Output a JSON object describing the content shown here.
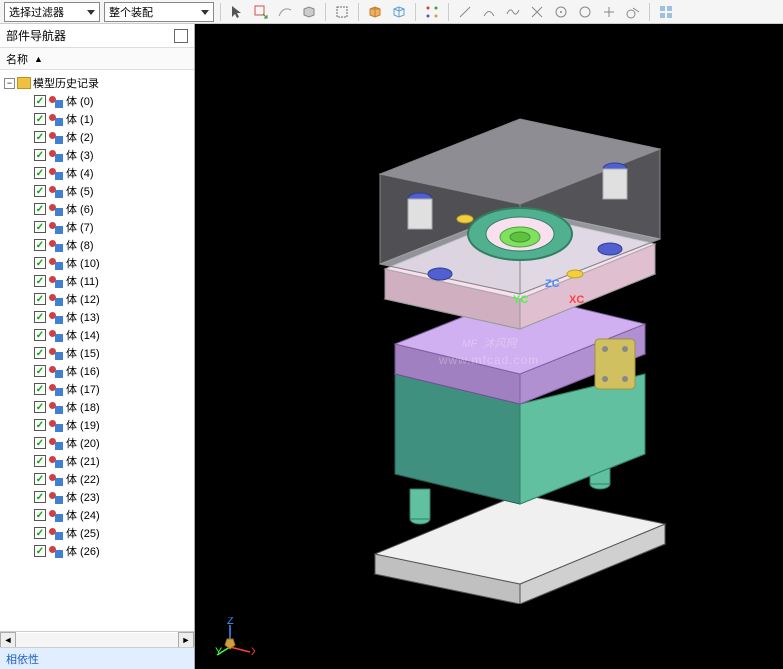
{
  "toolbar": {
    "filter_label": "选择过滤器",
    "assembly_label": "整个装配"
  },
  "sidebar": {
    "panel_title": "部件导航器",
    "column_name": "名称",
    "root_label": "模型历史记录",
    "item_prefix": "体",
    "dependency_title": "相依性"
  },
  "tree_items": [
    {
      "label": "体 (0)"
    },
    {
      "label": "体 (1)"
    },
    {
      "label": "体 (2)"
    },
    {
      "label": "体 (3)"
    },
    {
      "label": "体 (4)"
    },
    {
      "label": "体 (5)"
    },
    {
      "label": "体 (6)"
    },
    {
      "label": "体 (7)"
    },
    {
      "label": "体 (8)"
    },
    {
      "label": "体 (10)"
    },
    {
      "label": "体 (11)"
    },
    {
      "label": "体 (12)"
    },
    {
      "label": "体 (13)"
    },
    {
      "label": "体 (14)"
    },
    {
      "label": "体 (15)"
    },
    {
      "label": "体 (16)"
    },
    {
      "label": "体 (17)"
    },
    {
      "label": "体 (18)"
    },
    {
      "label": "体 (19)"
    },
    {
      "label": "体 (20)"
    },
    {
      "label": "体 (21)"
    },
    {
      "label": "体 (22)"
    },
    {
      "label": "体 (23)"
    },
    {
      "label": "体 (24)"
    },
    {
      "label": "体 (25)"
    },
    {
      "label": "体 (26)"
    }
  ],
  "viewport": {
    "axis_zc": "ZC",
    "axis_yc": "YC",
    "axis_xc": "XC",
    "triad_x": "X",
    "triad_y": "Y",
    "triad_z": "Z",
    "watermark_main": "沐风网",
    "watermark_sub": "www.mfcad.com",
    "watermark_logo": "MF"
  }
}
